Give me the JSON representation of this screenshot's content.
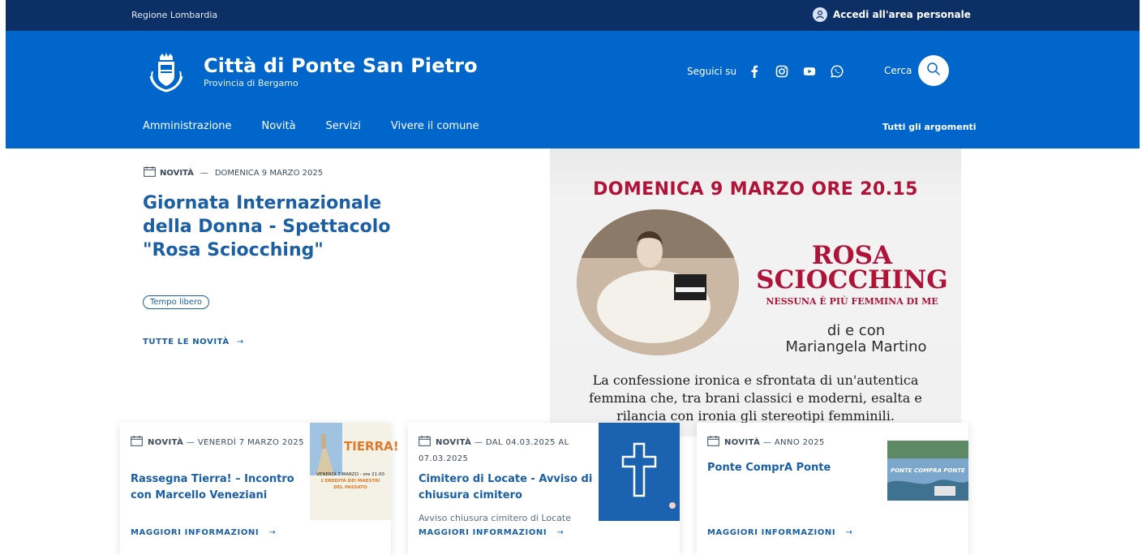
{
  "header_slim": {
    "region": "Regione Lombardia",
    "login": "Accedi all'area personale"
  },
  "header_center": {
    "title": "Città di Ponte San Pietro",
    "subtitle": "Provincia di Bergamo",
    "social_label": "Seguici su",
    "social_icons": [
      "facebook-icon",
      "instagram-icon",
      "youtube-icon",
      "whatsapp-icon"
    ],
    "search_label": "Cerca"
  },
  "nav": {
    "items": [
      "Amministrazione",
      "Novità",
      "Servizi",
      "Vivere il comune"
    ],
    "topics": "Tutti gli argomenti"
  },
  "hero": {
    "category": "NOVITÀ",
    "date": "DOMENICA 9 MARZO 2025",
    "title": "Giornata Internazionale della Donna - Spettacolo \"Rosa Sciocching\"",
    "tag": "Tempo libero",
    "all_news": "TUTTE LE NOVITÀ"
  },
  "poster": {
    "date": "DOMENICA 9 MARZO ORE 20.15",
    "name_line1": "ROSA",
    "name_line2": "SCIOCCHING",
    "tagline": "NESSUNA È PIÙ FEMMINA DI ME",
    "by_line1": "di e con",
    "by_line2": "Mariangela Martino",
    "description": "La confessione ironica e sfrontata di un'autentica femmina che, tra brani classici e moderni, esalta e rilancia con ironia gli stereotipi femminili."
  },
  "cards": [
    {
      "category": "NOVITÀ",
      "date": "VENERDÌ 7 MARZO 2025",
      "title": "Rassegna Tierra! – Incontro con Marcello Veneziani",
      "description": "",
      "more": "MAGGIORI INFORMAZIONI",
      "image": {
        "heading": "TIERRA!",
        "line1": "VENERDÌ 7 MARZO - ore 21.00",
        "line2": "L'EREDITÀ DEI MAESTRI",
        "line3": "DEL PASSATO"
      }
    },
    {
      "category": "NOVITÀ",
      "date": "DAL 04.03.2025 AL 07.03.2025",
      "title": "Cimitero di Locate - Avviso di chiusura cimitero",
      "description": "Avviso chiusura cimitero di Locate",
      "more": "MAGGIORI INFORMAZIONI"
    },
    {
      "category": "NOVITÀ",
      "date": "ANNO 2025",
      "title": "Ponte ComprA Ponte",
      "description": "",
      "more": "MAGGIORI INFORMAZIONI",
      "image": {
        "text": "PONTE COMPRA PONTE"
      }
    }
  ],
  "colors": {
    "slim_bar": "#0c2f66",
    "header": "#0066cc",
    "primary": "#1a5fa6",
    "poster_red": "#b01238"
  }
}
